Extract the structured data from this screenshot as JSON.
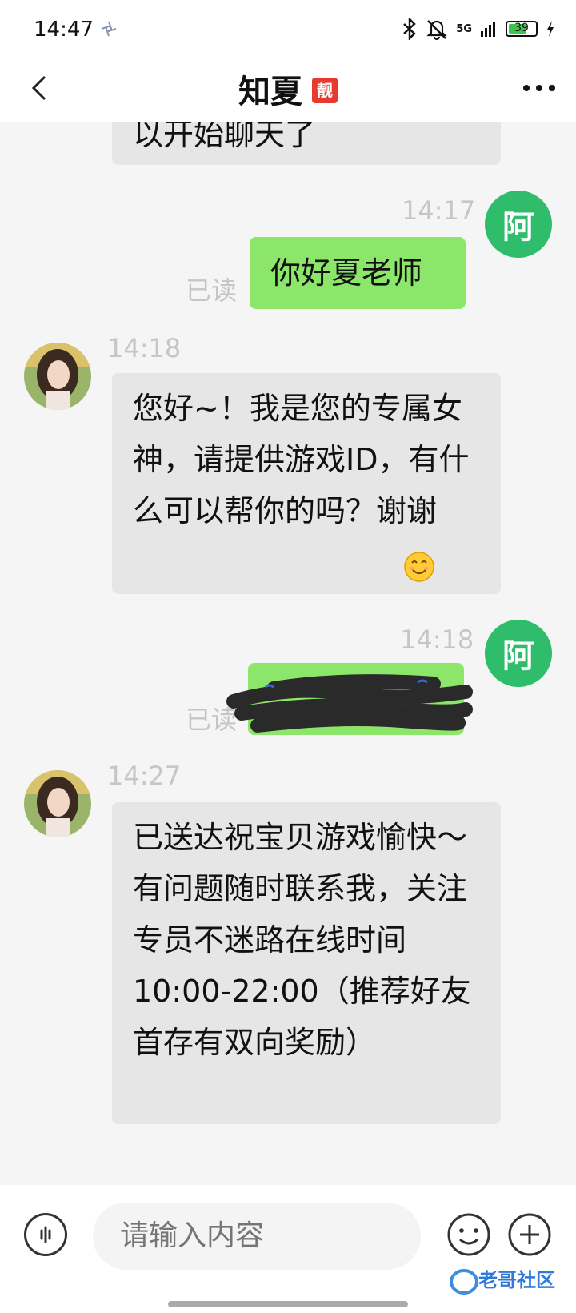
{
  "status_bar": {
    "time": "14:47",
    "network": "5G",
    "battery": "39"
  },
  "nav": {
    "title": "知夏",
    "badge": "靓"
  },
  "messages": [
    {
      "side": "left",
      "text": "以开始聊天了"
    },
    {
      "side": "right",
      "time": "14:17",
      "read": "已读",
      "avatar": "阿",
      "text": "你好夏老师"
    },
    {
      "side": "left",
      "time": "14:18",
      "text": "您好~！我是您的专属女神，请提供游戏ID，有什么可以帮你的吗？谢谢"
    },
    {
      "side": "right",
      "time": "14:18",
      "read": "已读",
      "avatar": "阿",
      "text": "",
      "redacted": true
    },
    {
      "side": "left",
      "time": "14:27",
      "text": "已送达祝宝贝游戏愉快～有问题随时联系我，关注专员不迷路在线时间10:00-22:00（推荐好友首存有双向奖励）"
    }
  ],
  "input": {
    "placeholder": "请输入内容"
  },
  "watermark": "老哥社区",
  "colors": {
    "self_bubble": "#8be66a",
    "peer_bubble": "#e6e6e6",
    "self_avatar": "#2fbd6b",
    "badge": "#e63b2e"
  }
}
